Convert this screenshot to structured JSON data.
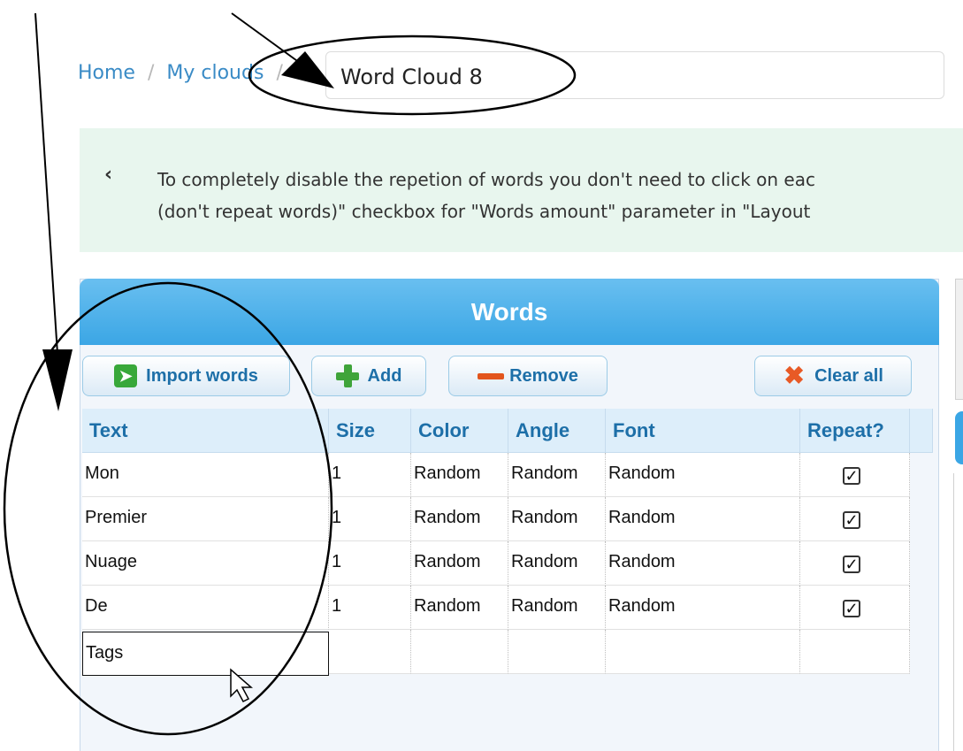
{
  "breadcrumb": {
    "home": "Home",
    "sep1": "/",
    "my_clouds": "My clouds",
    "sep2": "/"
  },
  "cloud_name": "Word Cloud 8",
  "info": {
    "line1": "To completely disable the repetion of words you don't need to click on eac",
    "line2": "(don't repeat words)\" checkbox for \"Words amount\" parameter in \"Layout"
  },
  "panel": {
    "title": "Words"
  },
  "toolbar": {
    "import_label": "Import words",
    "add_label": "Add",
    "remove_label": "Remove",
    "clear_label": "Clear all"
  },
  "table": {
    "headers": [
      "Text",
      "Size",
      "Color",
      "Angle",
      "Font",
      "Repeat?"
    ],
    "rows": [
      {
        "text": "Mon",
        "size": "1",
        "color": "Random",
        "angle": "Random",
        "font": "Random",
        "repeat": true
      },
      {
        "text": "Premier",
        "size": "1",
        "color": "Random",
        "angle": "Random",
        "font": "Random",
        "repeat": true
      },
      {
        "text": "Nuage",
        "size": "1",
        "color": "Random",
        "angle": "Random",
        "font": "Random",
        "repeat": true
      },
      {
        "text": "De",
        "size": "1",
        "color": "Random",
        "angle": "Random",
        "font": "Random",
        "repeat": true
      }
    ],
    "editing_value": "Tags",
    "check_glyph": "✓"
  },
  "colors": {
    "accent": "#3ba6e5",
    "banner": "#e8f6ee",
    "link": "#3a8bc6"
  }
}
